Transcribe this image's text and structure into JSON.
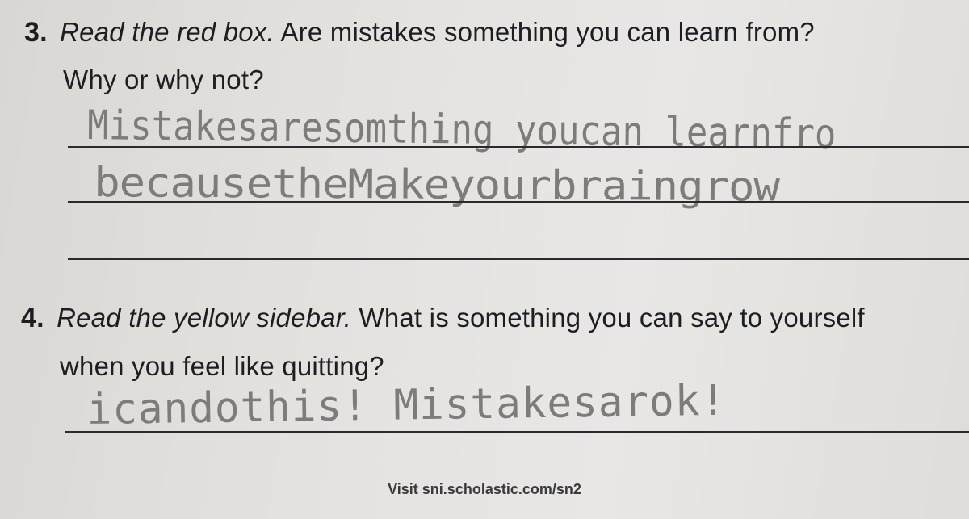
{
  "questions": [
    {
      "number": "3.",
      "lead": "Read the red box.",
      "prompt_line1": "Are mistakes something you can learn from?",
      "prompt_line2": "Why or why not?",
      "answer_lines": [
        "Mistakesaresomthing youcan learnfro",
        "becausetheMakeyourbraingrow",
        ""
      ]
    },
    {
      "number": "4.",
      "lead": "Read the yellow sidebar.",
      "prompt_line1": "What is something you can say to yourself",
      "prompt_line2": "when you feel like quitting?",
      "answer_lines": [
        "icandothis! Mistakesarok!"
      ]
    }
  ],
  "footer": "Visit sni.scholastic.com/sn2"
}
